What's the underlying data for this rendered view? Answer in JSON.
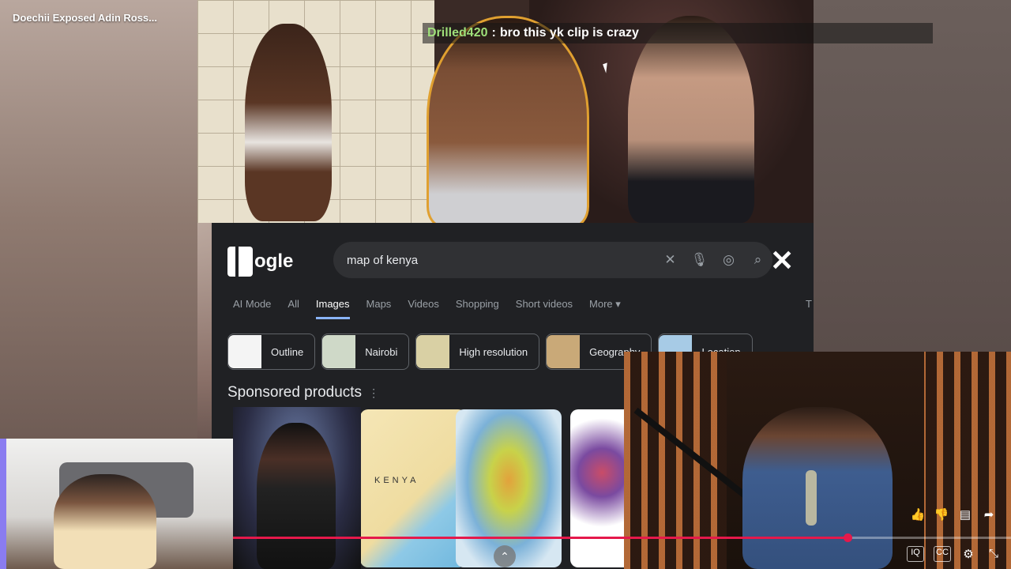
{
  "video": {
    "title": "Doechii Exposed Adin Ross..."
  },
  "chat": {
    "username": "Drilled420",
    "separator": ":",
    "message": "bro this yk clip is crazy",
    "username_color": "#9fe07a"
  },
  "google": {
    "logo_text": "ogle",
    "search_query": "map of kenya",
    "icons": [
      "clear-icon",
      "mic-icon",
      "lens-icon",
      "search-icon",
      "close-icon"
    ],
    "tabs": [
      {
        "label": "AI Mode",
        "active": false
      },
      {
        "label": "All",
        "active": false
      },
      {
        "label": "Images",
        "active": true
      },
      {
        "label": "Maps",
        "active": false
      },
      {
        "label": "Videos",
        "active": false
      },
      {
        "label": "Shopping",
        "active": false
      },
      {
        "label": "Short videos",
        "active": false
      },
      {
        "label": "More ▾",
        "active": false
      }
    ],
    "tools_label": "T",
    "chips": [
      {
        "label": "Outline",
        "color": "#f4f4f4"
      },
      {
        "label": "Nairobi",
        "color": "#cfd9c8"
      },
      {
        "label": "High resolution",
        "color": "#d9d0a4"
      },
      {
        "label": "Geography",
        "color": "#c9a978"
      },
      {
        "label": "Location",
        "color": "#a7cbe6"
      }
    ],
    "sponsored_label": "Sponsored products",
    "kenya_map_label": "KENYA",
    "accent_color": "#8ab4f8"
  },
  "player": {
    "progress_percent": 79,
    "accent_color": "#e5194b",
    "side_actions": [
      "like-icon",
      "dislike-icon",
      "comment-icon",
      "share-icon"
    ],
    "bottom_controls": [
      "IQ",
      "CC",
      "⚙",
      "⤡"
    ]
  }
}
